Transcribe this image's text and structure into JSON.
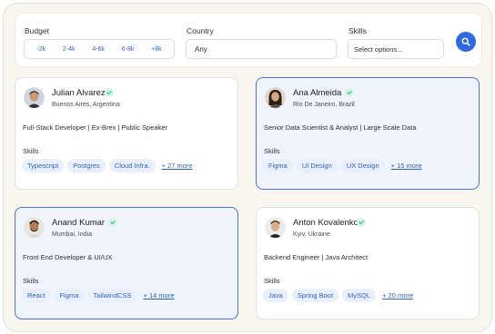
{
  "filters": {
    "budget_label": "Budget",
    "budget_options": [
      "-2k",
      "2-4k",
      "4-6k",
      "6-8k",
      "+8k"
    ],
    "country_label": "Country",
    "country_value": "Any",
    "skills_label": "Skills",
    "skills_placeholder": "Select options..."
  },
  "profiles": [
    {
      "name": "Julian Alvarez",
      "location": "Buenos Aires, Argentina",
      "title": "Full-Stack Developer | Ex-Brex | Public Speaker",
      "skills_label": "Skills",
      "skills": [
        "Typescript",
        "Postgres",
        "Cloud Infra."
      ],
      "more": "+ 27 more",
      "selected": false
    },
    {
      "name": "Ana Almeida",
      "location": "Rio De Janeiro, Brazil",
      "title": "Senior Data Scientist & Analyst | Large Scale Data",
      "skills_label": "Skills",
      "skills": [
        "Figma",
        "UI Design",
        "UX Design"
      ],
      "more": "+ 15 more",
      "selected": true
    },
    {
      "name": "Anand Kumar",
      "location": "Mumbai, India",
      "title": "Front End Developer & UI/UX",
      "skills_label": "Skills",
      "skills": [
        "React",
        "Figma",
        "TailwindCSS"
      ],
      "more": "+ 14 more",
      "selected": true
    },
    {
      "name": "Anton Kovalenko",
      "location": "Kyiv, Ukraine",
      "title": "Backend Engineer | Java Architect",
      "skills_label": "Skills",
      "skills": [
        "Java",
        "Spring Boot",
        "MySQL"
      ],
      "more": "+ 20 more",
      "selected": false
    }
  ],
  "colors": {
    "accent": "#2f6ae0",
    "verified": "#3cc48a",
    "chip_bg": "#e9f0fb",
    "selected_border": "#4b73d4"
  },
  "icons": {
    "search": "search-icon",
    "verified": "verified-check-icon",
    "avatar": "avatar"
  }
}
